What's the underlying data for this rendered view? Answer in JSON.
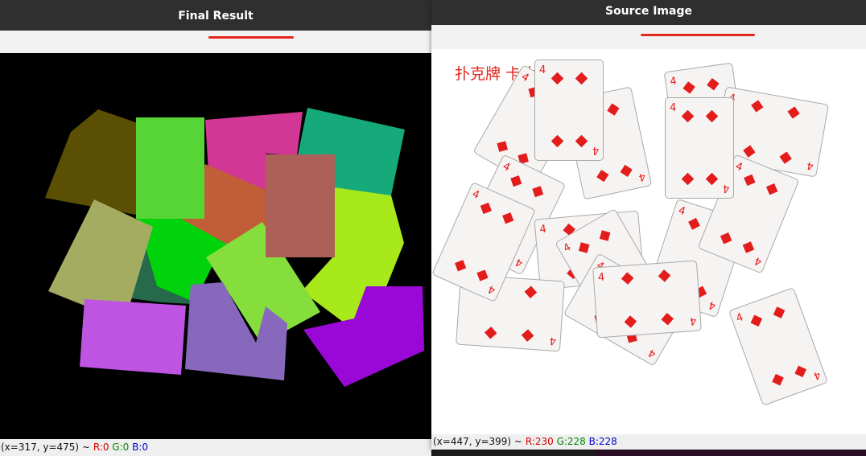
{
  "left_window": {
    "title": "Final Result",
    "status": {
      "coords": "(x=317, y=475) ~",
      "r": "R:0",
      "g": "G:0",
      "b": "B:0"
    },
    "segment_colors": [
      "#5b4f03",
      "#d23796",
      "#16a97a",
      "#c25e37",
      "#a8e91c",
      "#00d20c",
      "#256a4b",
      "#a3ac61",
      "#86de3d",
      "#57d436",
      "#ad6058",
      "#bd54e2",
      "#8768bc",
      "#9a08d8"
    ]
  },
  "right_window": {
    "title": "Source Image",
    "image_caption": "扑克牌 卡片检测",
    "card_rank": "4",
    "status": {
      "coords": "(x=447, y=399) ~",
      "r": "R:230",
      "g": "G:228",
      "b": "B:228"
    }
  },
  "accent_color": "#e4281d"
}
